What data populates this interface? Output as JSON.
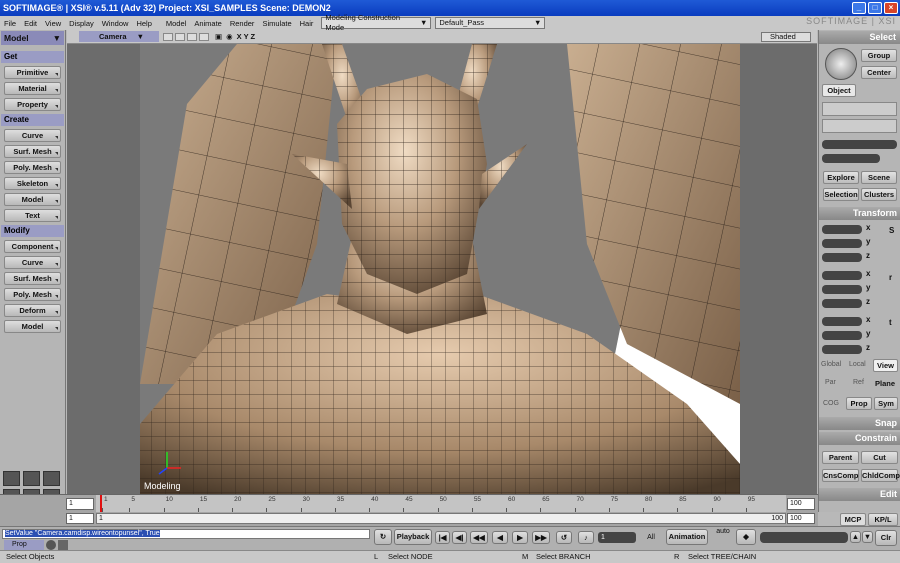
{
  "window": {
    "title": "SOFTIMAGE® | XSI® v.5.11 (Adv 32) Project: XSI_SAMPLES   Scene: DEMON2",
    "brand": "SOFTIMAGE | XSI"
  },
  "menu": {
    "items": [
      "File",
      "Edit",
      "View",
      "Display",
      "Window",
      "Help",
      "Model",
      "Animate",
      "Render",
      "Simulate",
      "Hair"
    ],
    "construction_mode": "Modeling Construction Mode",
    "pass": "Default_Pass"
  },
  "left_panel": {
    "module": "Model",
    "sections": [
      {
        "header": "Get",
        "buttons": [
          "Primitive",
          "Material",
          "Property"
        ]
      },
      {
        "header": "Create",
        "buttons": [
          "Curve",
          "Surf. Mesh",
          "Poly. Mesh",
          "Skeleton",
          "Model",
          "Text"
        ]
      },
      {
        "header": "Modify",
        "buttons": [
          "Component",
          "Curve",
          "Surf. Mesh",
          "Poly. Mesh",
          "Deform",
          "Model"
        ]
      }
    ]
  },
  "viewport": {
    "camera": "Camera",
    "axes": "X Y Z",
    "display_mode": "Shaded",
    "label": "Modeling"
  },
  "right_panel": {
    "select_header": "Select",
    "select_buttons": [
      "Group",
      "Center"
    ],
    "object_button": "Object",
    "explore_buttons": [
      "Explore",
      "Scene",
      "Selection",
      "Clusters"
    ],
    "transform_header": "Transform",
    "axes": [
      "x",
      "y",
      "z"
    ],
    "transform_letters": [
      "S",
      "r",
      "t"
    ],
    "ref_buttons": [
      "Global",
      "Local",
      "View",
      "Par",
      "Ref",
      "Plane"
    ],
    "mode_buttons": [
      "COG",
      "Prop",
      "Sym"
    ],
    "snap_header": "Snap",
    "constrain_header": "Constrain",
    "constrain_buttons": [
      "Parent",
      "Cut",
      "CnsComp",
      "ChldComp"
    ],
    "edit_header": "Edit",
    "tabs": [
      "MCP",
      "KP/L"
    ]
  },
  "timeline": {
    "start": "1",
    "end": "100",
    "range_start": "1",
    "range_end_a": "100",
    "range_end_b": "100",
    "range_inner": "1",
    "range_right": "100",
    "ticks": [
      "1",
      "5",
      "10",
      "15",
      "20",
      "25",
      "30",
      "35",
      "40",
      "45",
      "50",
      "55",
      "60",
      "65",
      "70",
      "75",
      "80",
      "85",
      "90",
      "95"
    ]
  },
  "bottom": {
    "command": "SetValue \"Camera.camdisp.wireontopunsel\", True",
    "prop_label": "Prop",
    "playback": "Playback",
    "frame": "1",
    "all": "All",
    "animation": "Animation",
    "auto": "auto",
    "clr": "Clr"
  },
  "status": {
    "left": "Select Objects",
    "hint1_key": "L",
    "hint1": "Select NODE",
    "hint2_key": "M",
    "hint2": "Select BRANCH",
    "hint3_key": "R",
    "hint3": "Select TREE/CHAIN"
  }
}
